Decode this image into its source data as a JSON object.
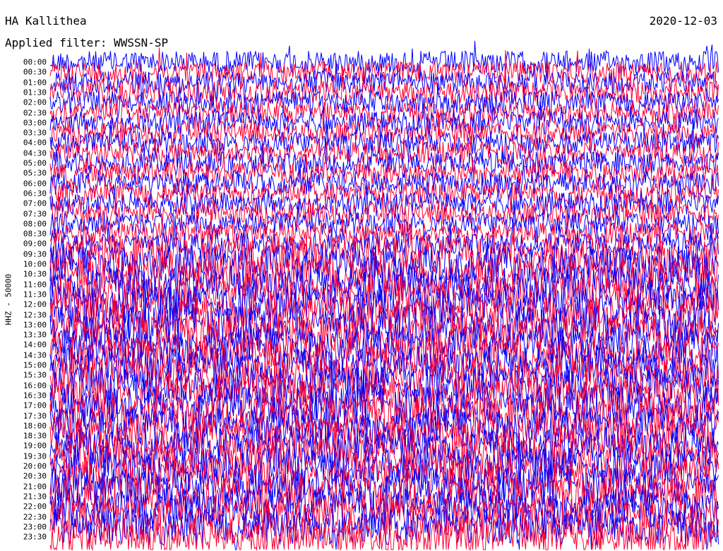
{
  "header": {
    "station": "HA Kallithea",
    "date": "2020-12-03",
    "filter": "Applied filter: WWSSN-SP"
  },
  "chart_data": {
    "type": "line",
    "title": "HA Kallithea",
    "ylabel": "HHZ - 50000",
    "row_labels": [
      "00:00",
      "00:30",
      "01:00",
      "01:30",
      "02:00",
      "02:30",
      "03:00",
      "03:30",
      "04:00",
      "04:30",
      "05:00",
      "05:30",
      "06:00",
      "06:30",
      "07:00",
      "07:30",
      "08:00",
      "08:30",
      "09:00",
      "09:30",
      "10:00",
      "10:30",
      "11:00",
      "11:30",
      "12:00",
      "12:30",
      "13:00",
      "13:30",
      "14:00",
      "14:30",
      "15:00",
      "15:30",
      "16:00",
      "16:30",
      "17:00",
      "17:30",
      "18:00",
      "18:30",
      "19:00",
      "19:30",
      "20:00",
      "20:30",
      "21:00",
      "21:30",
      "22:00",
      "22:30",
      "23:00",
      "23:30"
    ],
    "series": [
      {
        "values": "alternating traces",
        "color": "#0000ff"
      },
      {
        "values": "alternating traces",
        "color": "#ff0033"
      }
    ],
    "grid": false,
    "legend": "none"
  }
}
